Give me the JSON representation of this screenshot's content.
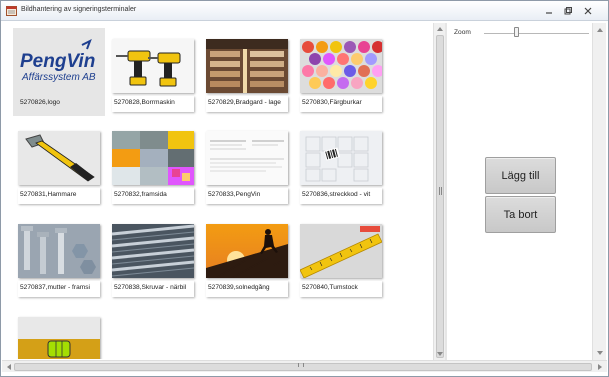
{
  "window": {
    "title": "Bildhantering av signeringsterminaler"
  },
  "gallery": {
    "tiles": [
      {
        "caption": "5270826,logo",
        "selected": true,
        "image": "pengvin-logo"
      },
      {
        "caption": "5270828,Borrmaskin",
        "image": "drills"
      },
      {
        "caption": "5270829,Bradgard - lage",
        "image": "warehouse"
      },
      {
        "caption": "5270830,Färgburkar",
        "image": "paint-cans"
      },
      {
        "caption": "5270831,Hammare",
        "image": "hammer"
      },
      {
        "caption": "5270832,framsida",
        "image": "collage"
      },
      {
        "caption": "5270833,PengVin",
        "image": "document"
      },
      {
        "caption": "5270836,streckkod - vit",
        "image": "barcode-puzzle"
      },
      {
        "caption": "5270837,mutter - framsi",
        "image": "nuts-bolts"
      },
      {
        "caption": "5270838,Skruvar - närbil",
        "image": "screws"
      },
      {
        "caption": "5270839,solnedgång",
        "image": "sunset-worker"
      },
      {
        "caption": "5270840,Tumstock",
        "image": "ruler"
      },
      {
        "caption": "",
        "image": "level"
      }
    ]
  },
  "logo": {
    "brand": "PengVin",
    "company": "Affärssystem AB",
    "color": "#1e3f8f"
  },
  "rightpane": {
    "zoom_label": "Zoom",
    "zoom_value": 0.3,
    "add_button": "Lägg till",
    "remove_button": "Ta bort"
  }
}
